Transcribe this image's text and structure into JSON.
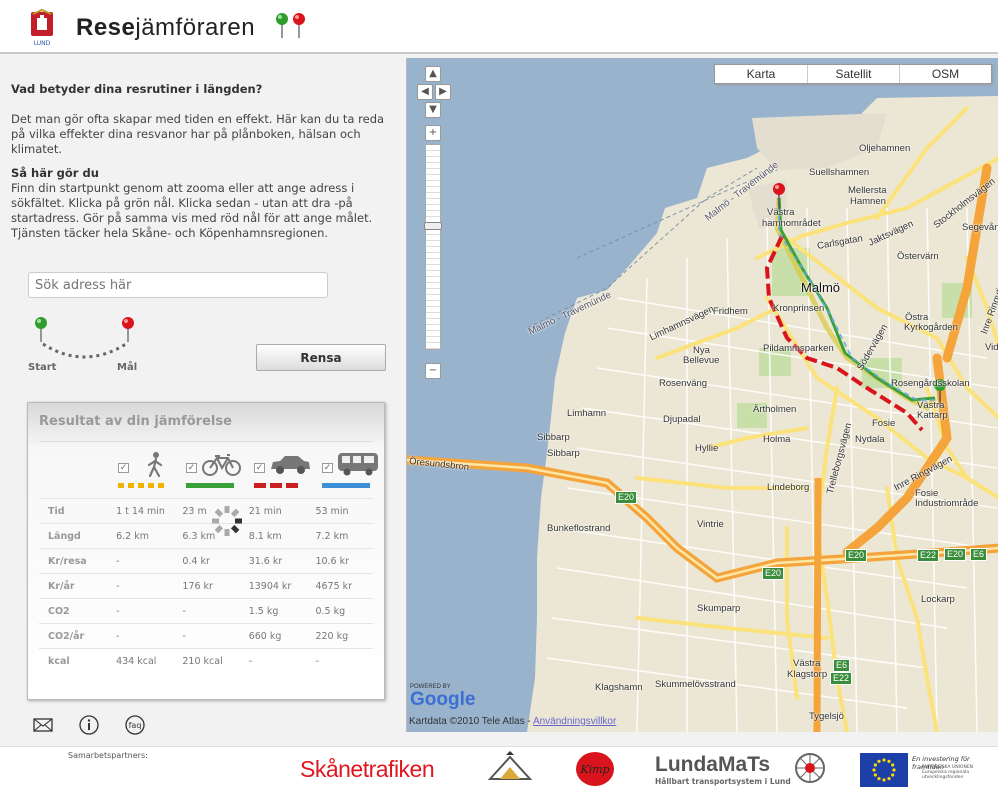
{
  "header": {
    "crest_caption": "LUND",
    "title_bold": "Rese",
    "title_rest": "jämföraren"
  },
  "intro": {
    "heading": "Vad betyder dina resrutiner i längden?",
    "paragraph": "Det man gör ofta skapar med tiden en effekt. Här kan du ta reda på vilka effekter dina resvanor har på plånboken, hälsan och klimatet.",
    "howto_heading": "Så här gör du",
    "howto_text": "Finn din startpunkt genom att zooma eller att ange adress i sökfältet. Klicka på grön nål. Klicka sedan - utan att dra -på startadress. Gör på samma vis med röd nål för att ange målet. Tjänsten täcker hela Skåne- och Köpenhamnsregionen."
  },
  "search": {
    "placeholder": "Sök adress här"
  },
  "pins": {
    "start_label": "Start",
    "goal_label": "Mål"
  },
  "buttons": {
    "clear_label": "Rensa"
  },
  "results": {
    "title": "Resultat av din jämförelse",
    "modes": [
      {
        "name": "walk",
        "icon": "walk-icon",
        "color": "#f0b400"
      },
      {
        "name": "bike",
        "icon": "bike-icon",
        "color": "#3aa13a"
      },
      {
        "name": "car",
        "icon": "car-icon",
        "color": "#cc1f1f"
      },
      {
        "name": "bus",
        "icon": "bus-icon",
        "color": "#3d8fd6"
      }
    ],
    "rows": [
      {
        "label": "Tid",
        "cells": [
          "1 t 14 min",
          "23 m",
          "21 min",
          "53 min"
        ]
      },
      {
        "label": "Längd",
        "cells": [
          "6.2 km",
          "6.3 km",
          "8.1 km",
          "7.2 km"
        ]
      },
      {
        "label": "Kr/resa",
        "cells": [
          "-",
          "0.4 kr",
          "31.6 kr",
          "10.6 kr"
        ]
      },
      {
        "label": "Kr/år",
        "cells": [
          "-",
          "176 kr",
          "13904 kr",
          "4675 kr"
        ]
      },
      {
        "label": "CO2",
        "cells": [
          "-",
          "-",
          "1.5 kg",
          "0.5 kg"
        ]
      },
      {
        "label": "CO2/år",
        "cells": [
          "-",
          "-",
          "660 kg",
          "220 kg"
        ]
      },
      {
        "label": "kcal",
        "cells": [
          "434 kcal",
          "210 kcal",
          "-",
          "-"
        ]
      }
    ]
  },
  "footer_icons": [
    "mail-icon",
    "info-icon",
    "faq-icon"
  ],
  "faq_label": "faq",
  "map": {
    "types": [
      "Karta",
      "Satellit",
      "OSM"
    ],
    "labels": {
      "oljehamnen": "Oljehamnen",
      "suellshamnen": "Suellshamnen",
      "mellersta": "Mellersta",
      "hamnen": "Hamnen",
      "vastra_hamnomradet_1": "Västra",
      "vastra_hamnomradet_2": "hamnområdet",
      "carlsgatan": "Carlsgatan",
      "jaktsvagen": "Jaktsvägen",
      "stockholmsvagen": "Stockholmsvägen",
      "segevang": "Segevång",
      "ostervarn": "Östervärn",
      "malmo": "Malmö",
      "fridhem": "Fridhem",
      "kronprinsen": "Kronprinsen",
      "ostra_1": "Östra",
      "ostra_2": "Kyrkogården",
      "inre_ringvagen": "Inre Ringvägen",
      "nya_1": "Nya",
      "nya_2": "Bellevue",
      "pildammsparken": "Pildammsparken",
      "sodervagen": "Södervägen",
      "rosengard": "Rosengårdsskolan",
      "rosenvang": "Rosenväng",
      "vastra_kattarp_1": "Västra",
      "vastra_kattarp_2": "Kattarp",
      "limhamn": "Limhamn",
      "djupadal": "Djupadal",
      "artholmen": "Ärtholmen",
      "fosie": "Fosie",
      "sibbarp1": "Sibbarp",
      "hyllie": "Hyllie",
      "holma": "Holma",
      "nydala": "Nydala",
      "sibbarp2": "Sibbarp",
      "trelleborgsvagen": "Trelleborgsvägen",
      "oresundsbron": "Öresundsbron",
      "inre_ringvagen2": "Inre Ringvägen",
      "lindeborg": "Lindeborg",
      "fosie_ind_1": "Fosie",
      "fosie_ind_2": "Industriområde",
      "bunkeflostrand": "Bunkeflostrand",
      "vintrie": "Vintrie",
      "skumparp": "Skumparp",
      "lockarp": "Lockarp",
      "vastra_klagstorp_1": "Västra",
      "vastra_klagstorp_2": "Klagstorp",
      "klagshamn": "Klagshamn",
      "skummelovsstrand": "Skummelövsstrand",
      "tygelsjo": "Tygelsjö",
      "limhamnsvagen": "Limhamnsvägen",
      "ferry1": "Malmö - Travemünde",
      "ferry2": "Malmö - Travemünde",
      "vidi": "Vid"
    },
    "shields": [
      "E20",
      "E20",
      "E22",
      "E20",
      "E6",
      "E20",
      "E6",
      "E22"
    ],
    "powered_by": "POWERED BY",
    "google": "Google",
    "copyright": "Kartdata ©2010 Tele Atlas - ",
    "terms_link": "Användningsvillkor"
  },
  "footer": {
    "partners_label": "Samarbetspartners:",
    "skanetrafiken": "Skånetrafiken",
    "lundamats": "LundaMaTs",
    "lundamats_sub": "Hållbart transportsystem i Lund",
    "eu_text": "En investering för framtiden",
    "eu_small": "EUROPEISKA UNIONEN Europeiska regionala utvecklingsfonden",
    "kimp": "Kimp"
  }
}
